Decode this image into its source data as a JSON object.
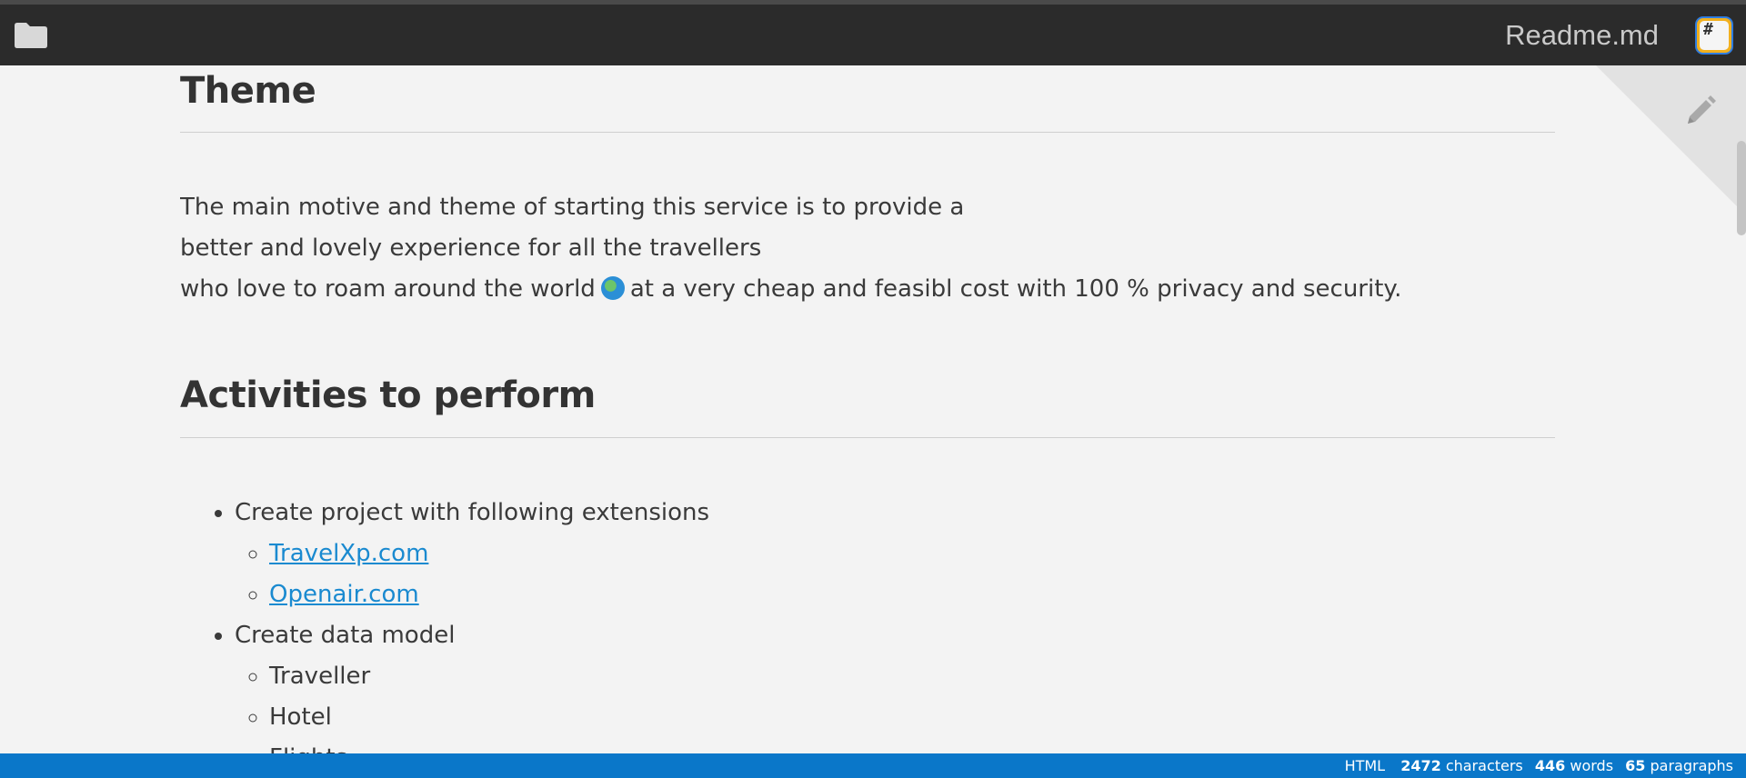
{
  "header": {
    "title": "Readme.md"
  },
  "sections": {
    "theme": {
      "heading": "Theme",
      "lines": [
        "The main motive and theme of starting this service is to provide a",
        "better and lovely experience for all the travellers",
        "who love to roam around the world",
        "at a very cheap and feasibl cost with 100 % privacy and security."
      ]
    },
    "activities": {
      "heading": "Activities to perform",
      "items": [
        {
          "label": "Create project with following extensions",
          "children": [
            "TravelXp.com",
            "Openair.com"
          ]
        },
        {
          "label": "Create data model",
          "children": [
            "Traveller",
            "Hotel",
            "Flights"
          ]
        }
      ]
    }
  },
  "status": {
    "mode": "HTML",
    "characters": "2472",
    "characters_label": "characters",
    "words": "446",
    "words_label": "words",
    "paragraphs": "65",
    "paragraphs_label": "paragraphs"
  },
  "icons": {
    "folder": "folder-icon",
    "markdown": "markdown-icon",
    "pencil": "pencil-icon",
    "globe": "globe-icon"
  },
  "colors": {
    "topbar": "#2b2b2b",
    "background": "#f3f3f3",
    "link": "#1a8ad0",
    "statusbar": "#0a77c9"
  }
}
